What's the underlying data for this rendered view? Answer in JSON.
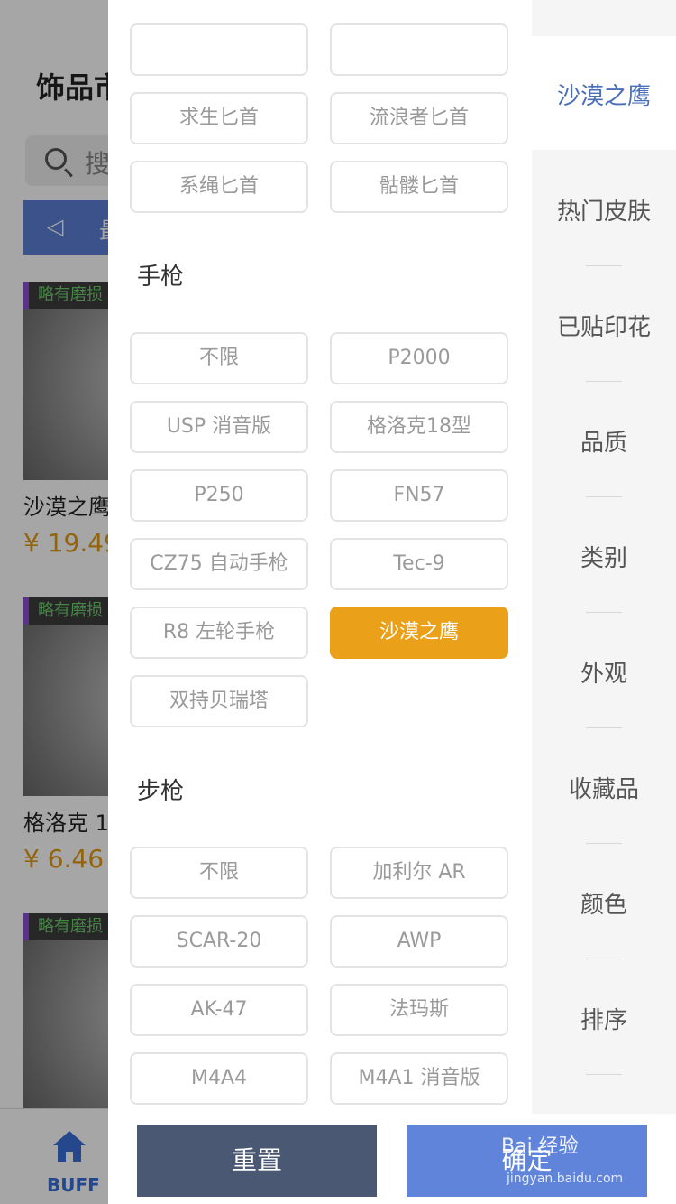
{
  "background": {
    "title": "饰品市",
    "search_placeholder": "搜",
    "notice_text": "最",
    "cards": [
      {
        "tag": "略有磨损",
        "name": "沙漠之鹰",
        "price": "¥ 19.49"
      },
      {
        "tag": "略有磨损",
        "name": "格洛克 1",
        "price": "¥ 6.46"
      },
      {
        "tag": "略有磨损",
        "name": "",
        "price": ""
      }
    ],
    "tabbar": {
      "home_label": "BUFF"
    }
  },
  "filter": {
    "partial_top": [
      "",
      ""
    ],
    "knife_items": [
      "求生匕首",
      "流浪者匕首",
      "系绳匕首",
      "骷髅匕首"
    ],
    "pistol": {
      "title": "手枪",
      "items": [
        "不限",
        "P2000",
        "USP 消音版",
        "格洛克18型",
        "P250",
        "FN57",
        "CZ75 自动手枪",
        "Tec-9",
        "R8 左轮手枪",
        "沙漠之鹰",
        "双持贝瑞塔"
      ],
      "selected": "沙漠之鹰"
    },
    "rifle": {
      "title": "步枪",
      "items": [
        "不限",
        "加利尔 AR",
        "SCAR-20",
        "AWP",
        "AK-47",
        "法玛斯",
        "M4A4",
        "M4A1 消音版"
      ]
    },
    "categories": [
      {
        "label": "沙漠之鹰",
        "active": true
      },
      {
        "label": "热门皮肤"
      },
      {
        "label": "已贴印花"
      },
      {
        "label": "品质"
      },
      {
        "label": "类别"
      },
      {
        "label": "外观"
      },
      {
        "label": "收藏品"
      },
      {
        "label": "颜色"
      },
      {
        "label": "排序"
      }
    ],
    "footer": {
      "reset_label": "重置",
      "confirm_label": "确定"
    }
  },
  "watermark": {
    "brand": "Bai 经验",
    "url": "jingyan.baidu.com"
  },
  "colors": {
    "accent_selected": "#eaa018",
    "reset_bg": "#4a5873",
    "confirm_bg": "#5f84d9",
    "category_active": "#4a6fb8"
  }
}
